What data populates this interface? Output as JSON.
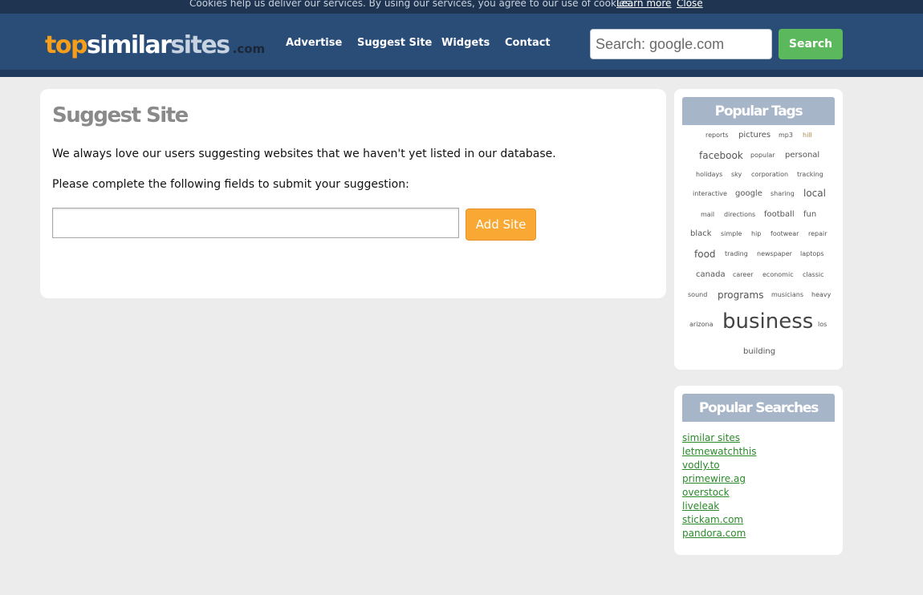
{
  "cookie_bar": {
    "message": "Cookies help us deliver our services. By using our services, you agree to our use of cookies.",
    "learn_more": "Learn more",
    "close": "Close"
  },
  "logo": {
    "top": "top",
    "similar": "similar",
    "sites": "sites",
    "com": ".com"
  },
  "nav": [
    "Advertise",
    "Suggest Site",
    "Widgets",
    "Contact"
  ],
  "search": {
    "placeholder": "Search: google.com",
    "button": "Search"
  },
  "main": {
    "title": "Suggest Site",
    "intro": "We always love our users suggesting websites that we haven't yet listed in our database.",
    "instruction": "Please complete the following fields to submit your suggestion:",
    "site_input_value": "",
    "add_button": "Add Site"
  },
  "popular_tags": {
    "title": "Popular Tags",
    "tags": [
      "reports",
      "pictures",
      "mp3",
      "hill",
      "facebook",
      "popular",
      "personal",
      "holidays",
      "sky",
      "corporation",
      "tracking",
      "interactive",
      "google",
      "sharing",
      "local",
      "mail",
      "directions",
      "football",
      "fun",
      "black",
      "simple",
      "hip",
      "footwear",
      "repair",
      "food",
      "trading",
      "newspaper",
      "laptops",
      "canada",
      "career",
      "economic",
      "classic",
      "sound",
      "programs",
      "musicians",
      "heavy",
      "arizona",
      "business",
      "los",
      "building"
    ]
  },
  "popular_searches": {
    "title": "Popular Searches",
    "items": [
      "similar sites",
      "letmewatchthis",
      "vodly.to",
      "primewire.ag",
      "overstock",
      "liveleak",
      "stickam.com",
      "pandora.com"
    ]
  },
  "colors": {
    "header": "#2a4d78",
    "cookie_bar": "#1e3450",
    "logo_orange": "#f59e1c",
    "search_button": "#5cb85c",
    "add_button": "#f8a833",
    "side_header": "#a7b5c9",
    "link_green": "#2a8a2a"
  }
}
